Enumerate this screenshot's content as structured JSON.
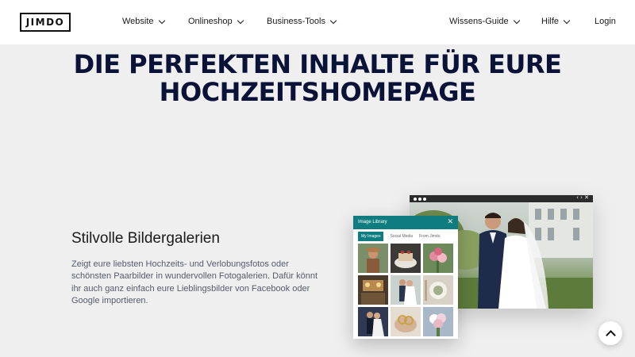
{
  "nav": {
    "logo": "JIMDO",
    "website": "Website",
    "onlineshop": "Onlineshop",
    "business_tools": "Business-Tools",
    "wissens_guide": "Wissens-Guide",
    "hilfe": "Hilfe",
    "login": "Login"
  },
  "headline": {
    "line1": "DIE PERFEKTEN INHALTE FÜR EURE",
    "line2": "HOCHZEITSHOMEPAGE"
  },
  "feature": {
    "title": "Stilvolle Bildergalerien",
    "description": "Zeigt eure liebsten Hochzeits- und Verlobungsfotos oder schönsten Paarbilder in wundervollen Fotogalerien. Dafür könnt ihr auch ganz einfach eure Lieblingsbilder von Facebook oder Google importieren."
  },
  "mockup": {
    "panel_title": "Image Library",
    "close_glyph": "✕",
    "tabs": [
      "My Images",
      "Social Media",
      "From Jimdo"
    ],
    "browser_controls": "‹ ›  ✕"
  },
  "colors": {
    "headline": "#0b1238",
    "panel_accent": "#0f7d7f",
    "background": "#efefef"
  },
  "icons": {
    "chevron": "chevron-down-icon",
    "scroll_top": "chevron-up-icon"
  }
}
